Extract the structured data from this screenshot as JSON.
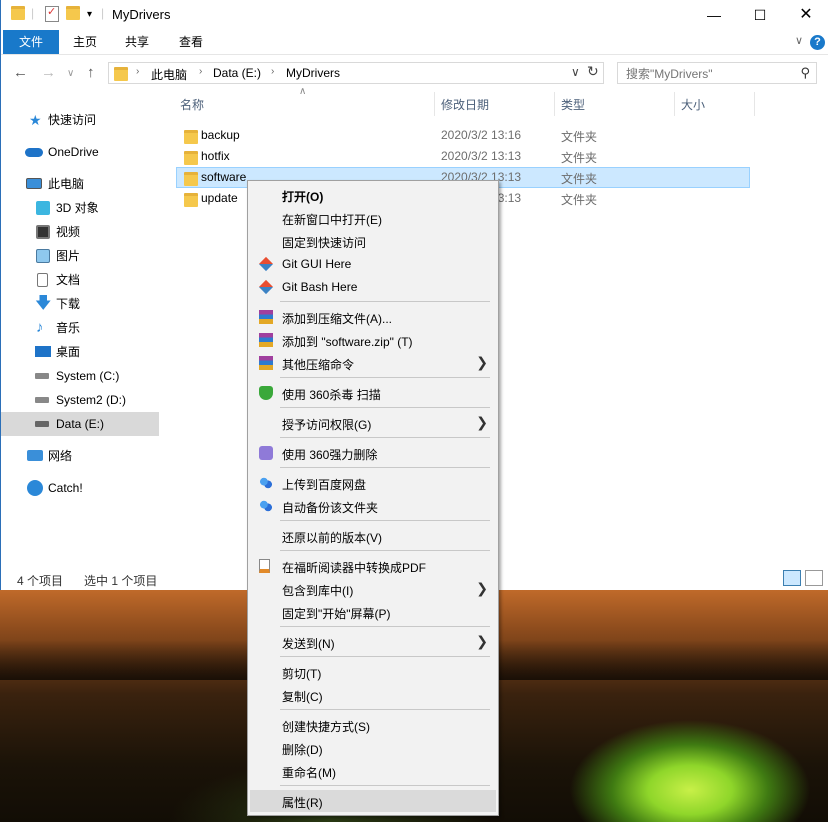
{
  "window": {
    "title": "MyDrivers"
  },
  "ribbon": {
    "tabs": [
      "文件",
      "主页",
      "共享",
      "查看"
    ]
  },
  "address": {
    "crumbs": [
      "此电脑",
      "Data (E:)",
      "MyDrivers"
    ]
  },
  "search": {
    "placeholder": "搜索\"MyDrivers\""
  },
  "sidebar": {
    "items": [
      {
        "label": "快速访问",
        "icon": "star-icon"
      },
      {
        "label": "OneDrive",
        "icon": "cloud-icon"
      },
      {
        "label": "此电脑",
        "icon": "computer-icon"
      },
      {
        "label": "3D 对象",
        "icon": "cube-icon"
      },
      {
        "label": "视频",
        "icon": "video-icon"
      },
      {
        "label": "图片",
        "icon": "picture-icon"
      },
      {
        "label": "文档",
        "icon": "document-icon"
      },
      {
        "label": "下载",
        "icon": "download-icon"
      },
      {
        "label": "音乐",
        "icon": "music-icon"
      },
      {
        "label": "桌面",
        "icon": "desktop-icon"
      },
      {
        "label": "System (C:)",
        "icon": "drive-icon"
      },
      {
        "label": "System2 (D:)",
        "icon": "drive-icon"
      },
      {
        "label": "Data (E:)",
        "icon": "drive-icon"
      },
      {
        "label": "网络",
        "icon": "network-icon"
      },
      {
        "label": "Catch!",
        "icon": "catch-icon"
      }
    ]
  },
  "columns": {
    "name": "名称",
    "date": "修改日期",
    "type": "类型",
    "size": "大小"
  },
  "files": [
    {
      "name": "backup",
      "date": "2020/3/2 13:16",
      "type": "文件夹"
    },
    {
      "name": "hotfix",
      "date": "2020/3/2 13:13",
      "type": "文件夹"
    },
    {
      "name": "software",
      "date": "2020/3/2 13:13",
      "type": "文件夹"
    },
    {
      "name": "update",
      "date": "2020/3/2 13:13",
      "type": "文件夹"
    }
  ],
  "status": {
    "count": "4 个项目",
    "selected": "选中 1 个项目"
  },
  "context_menu": {
    "items": [
      {
        "label": "打开(O)",
        "bold": true
      },
      {
        "label": "在新窗口中打开(E)"
      },
      {
        "label": "固定到快速访问"
      },
      {
        "label": "Git GUI Here",
        "icon": "git-icon"
      },
      {
        "label": "Git Bash Here",
        "icon": "git-icon"
      },
      {
        "label": "添加到压缩文件(A)...",
        "icon": "archive-icon"
      },
      {
        "label": "添加到 \"software.zip\" (T)",
        "icon": "archive-icon"
      },
      {
        "label": "其他压缩命令",
        "icon": "archive-icon",
        "submenu": true
      },
      {
        "label": "使用 360杀毒 扫描",
        "icon": "shield-icon"
      },
      {
        "label": "授予访问权限(G)",
        "submenu": true
      },
      {
        "label": "使用 360强力删除",
        "icon": "delete-tool-icon"
      },
      {
        "label": "上传到百度网盘",
        "icon": "baidu-cloud-icon"
      },
      {
        "label": "自动备份该文件夹",
        "icon": "baidu-cloud-icon"
      },
      {
        "label": "还原以前的版本(V)"
      },
      {
        "label": "在福昕阅读器中转换成PDF",
        "icon": "pdf-icon"
      },
      {
        "label": "包含到库中(I)",
        "submenu": true
      },
      {
        "label": "固定到\"开始\"屏幕(P)"
      },
      {
        "label": "发送到(N)",
        "submenu": true
      },
      {
        "label": "剪切(T)"
      },
      {
        "label": "复制(C)"
      },
      {
        "label": "创建快捷方式(S)"
      },
      {
        "label": "删除(D)"
      },
      {
        "label": "重命名(M)"
      },
      {
        "label": "属性(R)"
      }
    ]
  },
  "colors": {
    "accent": "#1979ca",
    "selection": "#cce8ff",
    "menu_bg": "#f2f2f2"
  }
}
